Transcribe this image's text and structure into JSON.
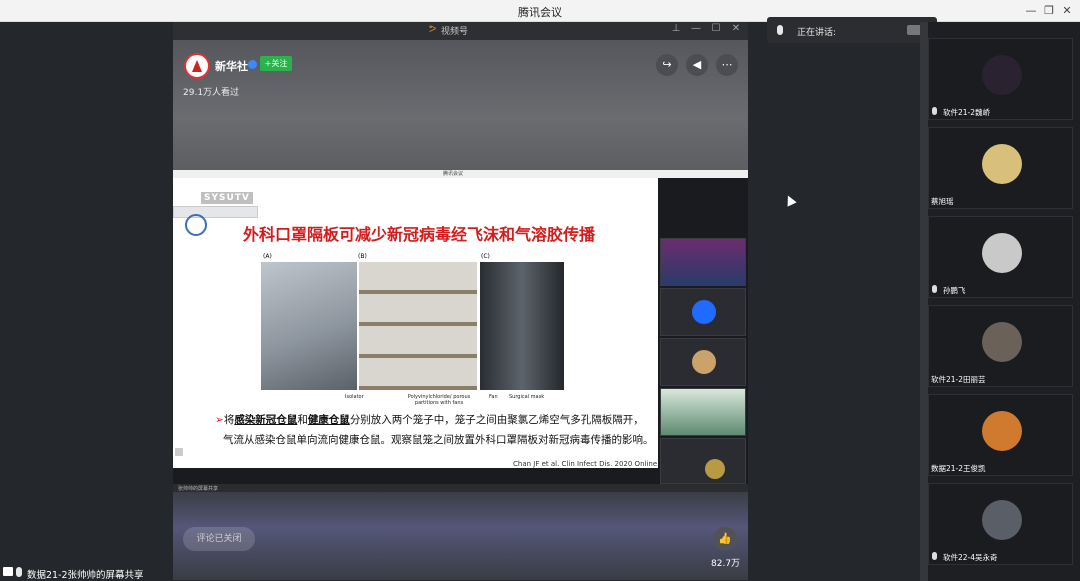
{
  "app": {
    "title": "腾讯会议"
  },
  "window_controls": {
    "minimize": "—",
    "maximize": "❐",
    "close": "✕"
  },
  "video_window": {
    "brand": "视频号",
    "controls": {
      "pin": "⊥",
      "minimize": "—",
      "maximize": "☐",
      "close": "✕"
    },
    "channel_name": "新华社",
    "follow_label": "+关注",
    "view_count": "29.1万人看过",
    "comment_label": "评论已关闭",
    "like_count": "82.7万",
    "inner_window_title": "腾讯会议",
    "slide": {
      "badge": "SYSUTV",
      "title": "外科口罩隔板可减少新冠病毒经飞沫和气溶胶传播",
      "panel_labels": [
        "(A)",
        "(B)",
        "(C)"
      ],
      "captions": [
        "Isolator",
        "Polyvinylchloride/ porous partitions with fans",
        "Fan",
        "Surgical mask"
      ],
      "bullet_pre": "将",
      "bullet_b1": "感染新冠仓鼠",
      "bullet_mid1": "和",
      "bullet_b2": "健康仓鼠",
      "bullet_post": "分别放入两个笼子中，笼子之间由聚氯乙烯空气多孔隔板隔开，",
      "bullet_line2": "气流从感染仓鼠单向流向健康仓鼠。观察鼠笼之间放置外科口罩隔板对新冠病毒传播的影响。",
      "citation": "Chan JF et al. Clin Infect Dis. 2020 Online"
    },
    "taskbar_text": "张帅帅的屏幕共享"
  },
  "speaking": {
    "label": "正在讲话:"
  },
  "share_status": {
    "label": "数据21-2张帅帅的屏幕共享"
  },
  "participants": [
    {
      "name": "软件21-2魏峤",
      "mic": true,
      "color": "#2a2230"
    },
    {
      "name": "蔡旭瑶",
      "mic": false,
      "color": "#d9c07a"
    },
    {
      "name": "孙鹏飞",
      "mic": true,
      "color": "#c9c9c9"
    },
    {
      "name": "软件21-2田丽芸",
      "mic": false,
      "color": "#6a6258"
    },
    {
      "name": "数据21-2王俊凯",
      "mic": false,
      "color": "#d07a30"
    },
    {
      "name": "软件22-4吴永奇",
      "mic": true,
      "color": "#5a5e66"
    }
  ]
}
